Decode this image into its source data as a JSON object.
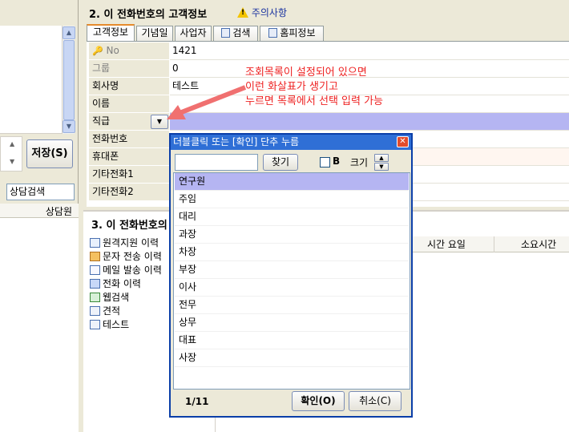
{
  "left_panel": {
    "save_label": "저장(S)",
    "search_value": "상담검색",
    "column_header": "상담원"
  },
  "section2": {
    "title": "2. 이 전화번호의 고객정보",
    "notice_label": "주의사항",
    "tabs": [
      {
        "label": "고객정보",
        "active": true
      },
      {
        "label": "기념일",
        "active": false
      },
      {
        "label": "사업자",
        "active": false
      },
      {
        "label": "검색",
        "active": false
      },
      {
        "label": "홈피정보",
        "active": false
      }
    ],
    "fields": [
      {
        "label": "No",
        "value": "1421",
        "dim": true,
        "icon": "key-icon"
      },
      {
        "label": "그룹",
        "value": "0",
        "dim": true
      },
      {
        "label": "회사명",
        "value": "테스트",
        "dim": false
      },
      {
        "label": "이름",
        "value": "",
        "dim": false
      },
      {
        "label": "직급",
        "value": "",
        "dim": false
      },
      {
        "label": "전화번호",
        "value": "",
        "dim": false
      },
      {
        "label": "휴대폰",
        "value": "",
        "dim": false
      },
      {
        "label": "기타전화1",
        "value": "",
        "dim": false
      },
      {
        "label": "기타전화2",
        "value": "",
        "dim": false
      }
    ]
  },
  "annotation": {
    "line1": "조회목록이 설정되어 있으면",
    "line2": "이런 화살표가 생기고",
    "line3": "누르면 목록에서 선택 입력 가능"
  },
  "section3": {
    "title": "3. 이 전화번호의",
    "tree": [
      {
        "label": "원격지원 이력",
        "icon": "remote-icon"
      },
      {
        "label": "문자 전송 이력",
        "icon": "sms-icon"
      },
      {
        "label": "메일 발송 이력",
        "icon": "mail-icon"
      },
      {
        "label": "전화 이력",
        "icon": "phone-icon"
      },
      {
        "label": "웹검색",
        "icon": "web-icon"
      },
      {
        "label": "견적",
        "icon": "doc-icon"
      },
      {
        "label": "테스트",
        "icon": "doc-icon"
      }
    ],
    "headers": [
      "시간 요일",
      "소요시간"
    ]
  },
  "dialog": {
    "title": "더블클릭 또는 [확인] 단추 누름",
    "search_value": "",
    "find_label": "찾기",
    "bold_label": "B",
    "size_label": "크기",
    "items": [
      "연구원",
      "주임",
      "대리",
      "과장",
      "차장",
      "부장",
      "이사",
      "전무",
      "상무",
      "대표",
      "사장"
    ],
    "selected_index": 0,
    "page_info": "1/11",
    "ok_label": "확인(O)",
    "cancel_label": "취소(C)"
  }
}
